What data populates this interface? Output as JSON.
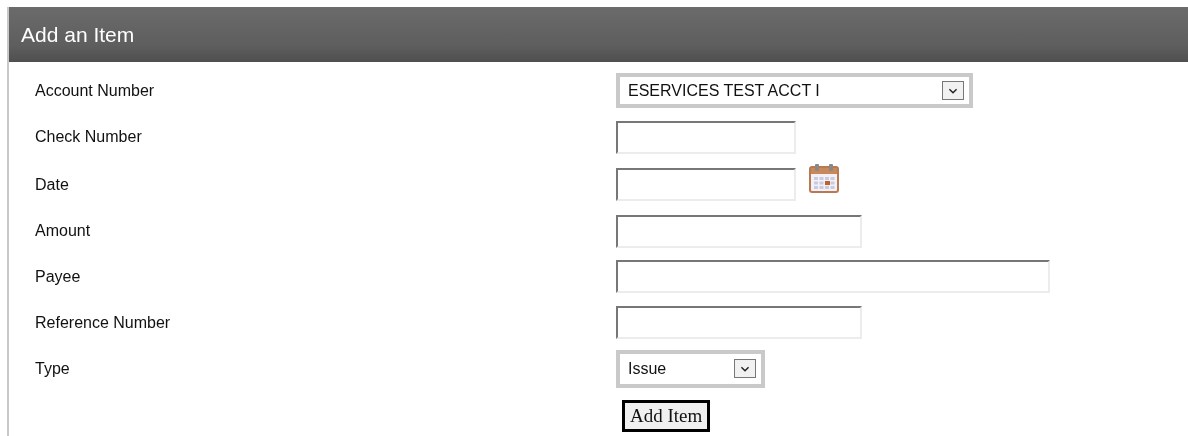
{
  "panel": {
    "title": "Add an Item"
  },
  "fields": [
    {
      "label": "Account Number",
      "kind": "select",
      "value": "ESERVICES TEST ACCT I"
    },
    {
      "label": "Check Number",
      "kind": "text"
    },
    {
      "label": "Date",
      "kind": "date"
    },
    {
      "label": "Amount",
      "kind": "text"
    },
    {
      "label": "Payee",
      "kind": "text"
    },
    {
      "label": "Reference Number",
      "kind": "text"
    },
    {
      "label": "Type",
      "kind": "select",
      "value": "Issue"
    }
  ],
  "submit": {
    "label": "Add Item"
  }
}
